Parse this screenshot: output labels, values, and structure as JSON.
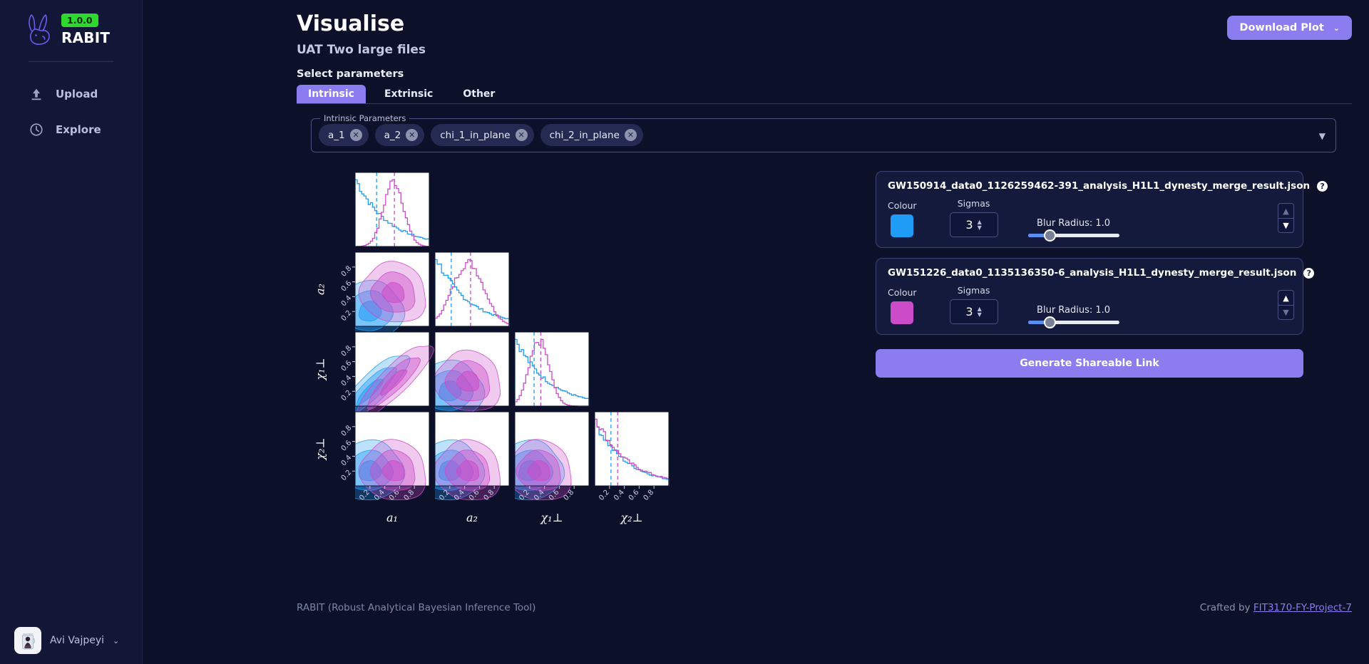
{
  "sidebar": {
    "version": "1.0.0",
    "brand": "RABIT",
    "items": [
      {
        "label": "Upload",
        "icon": "upload-icon"
      },
      {
        "label": "Explore",
        "icon": "clock-icon"
      }
    ],
    "user": {
      "name": "Avi Vajpeyi",
      "caret": "⌄"
    }
  },
  "header": {
    "title": "Visualise",
    "subtitle": "UAT Two large files",
    "download_label": "Download Plot",
    "download_caret": "⌄"
  },
  "params": {
    "section_label": "Select parameters",
    "tabs": [
      {
        "label": "Intrinsic",
        "active": true
      },
      {
        "label": "Extrinsic",
        "active": false
      },
      {
        "label": "Other",
        "active": false
      }
    ],
    "fieldset_legend": "Intrinsic Parameters",
    "chips": [
      "a_1",
      "a_2",
      "chi_1_in_plane",
      "chi_2_in_plane"
    ],
    "chip_remove_glyph": "✕",
    "dropdown_caret": "▼"
  },
  "files": [
    {
      "name": "GW150914_data0_1126259462-391_analysis_H1L1_dynesty_merge_result.json",
      "help_glyph": "?",
      "colour_label": "Colour",
      "colour": "#1f9cf5",
      "sigmas_label": "Sigmas",
      "sigmas": "3",
      "blur_label": "Blur Radius: 1.0",
      "blur_value": 1.0,
      "up_enabled": false,
      "down_enabled": true
    },
    {
      "name": "GW151226_data0_1135136350-6_analysis_H1L1_dynesty_merge_result.json",
      "help_glyph": "?",
      "colour_label": "Colour",
      "colour": "#cc4bc8",
      "sigmas_label": "Sigmas",
      "sigmas": "3",
      "blur_label": "Blur Radius: 1.0",
      "blur_value": 1.0,
      "up_enabled": true,
      "down_enabled": false
    }
  ],
  "share_button_label": "Generate Shareable Link",
  "footer": {
    "left": "RABIT (Robust Analytical Bayesian Inference Tool)",
    "crafted_prefix": "Crafted by ",
    "crafted_link": "FIT3170-FY-Project-7"
  },
  "chart_data": {
    "type": "scatter",
    "title": "",
    "subtitle": "Corner plot (pairwise posterior distributions)",
    "layout": "corner",
    "grid": false,
    "legend_position": "none",
    "parameters": [
      "a_1",
      "a_2",
      "chi_1_in_plane",
      "chi_2_in_plane"
    ],
    "xlabels": [
      "a₁",
      "a₂",
      "χ₁⊥",
      "χ₂⊥"
    ],
    "ylabels": [
      "a₂",
      "χ₁⊥",
      "χ₂⊥"
    ],
    "tick_values": [
      0.2,
      0.4,
      0.6,
      0.8
    ],
    "xlim": [
      0.0,
      1.0
    ],
    "ylim": [
      0.0,
      1.0
    ],
    "series": [
      {
        "name": "GW150914_data0_1126259462-391_analysis_H1L1_dynesty_merge_result.json",
        "colour": "#1f9cf5",
        "sigmas": 3,
        "marginals": {
          "a_1": {
            "shape": "monotonic-decreasing",
            "median": 0.29
          },
          "a_2": {
            "shape": "monotonic-decreasing",
            "median": 0.22
          },
          "chi_1_in_plane": {
            "shape": "monotonic-decreasing",
            "median": 0.26
          },
          "chi_2_in_plane": {
            "shape": "monotonic-decreasing",
            "median": 0.22
          }
        }
      },
      {
        "name": "GW151226_data0_1135136350-6_analysis_H1L1_dynesty_merge_result.json",
        "colour": "#cc4bc8",
        "sigmas": 3,
        "marginals": {
          "a_1": {
            "shape": "peaked",
            "median": 0.53,
            "peak": 0.52
          },
          "a_2": {
            "shape": "broad-peaked",
            "median": 0.48,
            "peak": 0.45
          },
          "chi_1_in_plane": {
            "shape": "peaked",
            "median": 0.35,
            "peak": 0.33
          },
          "chi_2_in_plane": {
            "shape": "monotonic-decreasing",
            "median": 0.31
          }
        }
      }
    ]
  }
}
